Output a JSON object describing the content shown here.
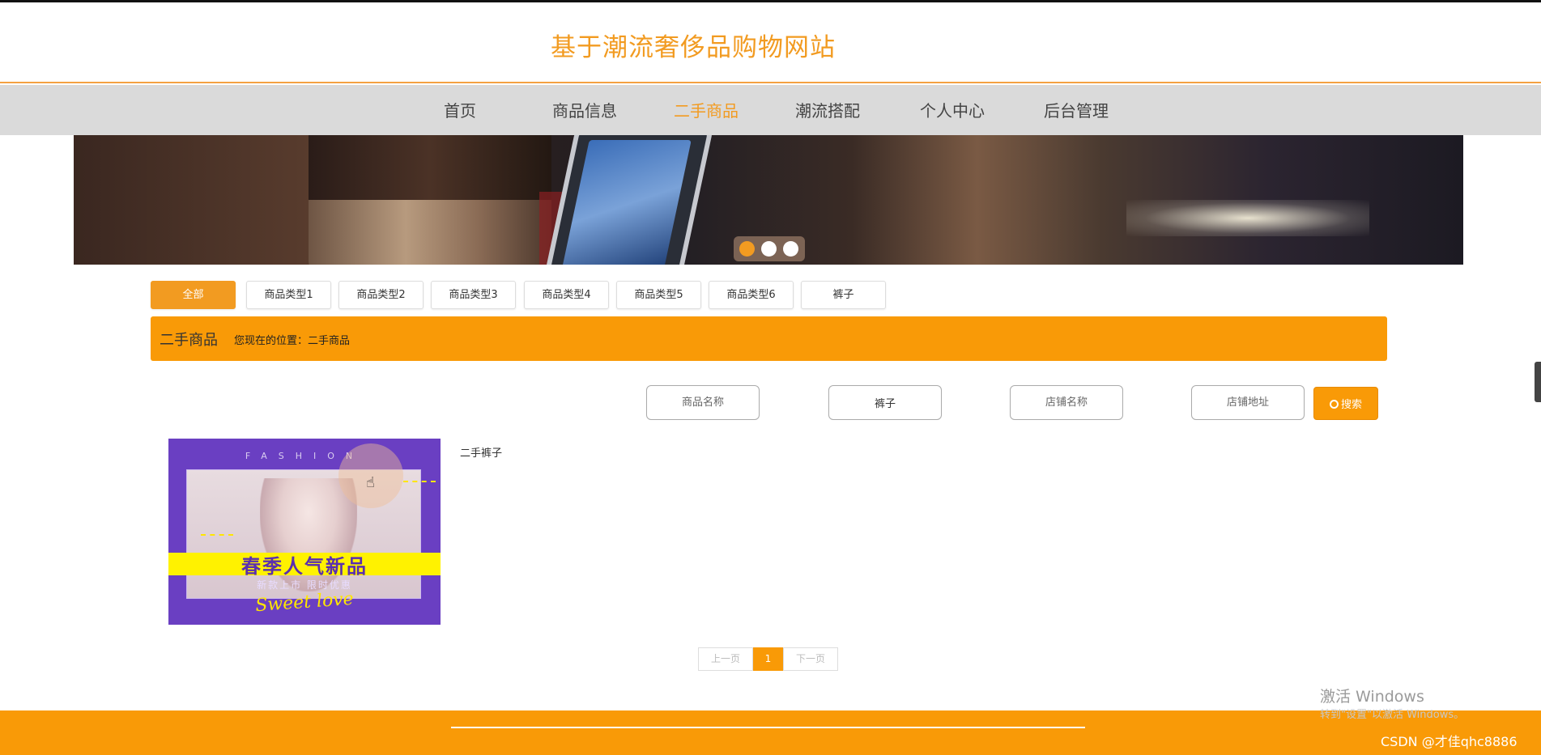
{
  "header": {
    "site_title": "基于潮流奢侈品购物网站"
  },
  "nav": {
    "items": [
      {
        "label": "首页"
      },
      {
        "label": "商品信息"
      },
      {
        "label": "二手商品",
        "active": true
      },
      {
        "label": "潮流搭配"
      },
      {
        "label": "个人中心"
      },
      {
        "label": "后台管理"
      }
    ]
  },
  "banner": {
    "slides": 3,
    "active_slide": 1
  },
  "categories": [
    {
      "label": "全部",
      "active": true
    },
    {
      "label": "商品类型1"
    },
    {
      "label": "商品类型2"
    },
    {
      "label": "商品类型3"
    },
    {
      "label": "商品类型4"
    },
    {
      "label": "商品类型5"
    },
    {
      "label": "商品类型6"
    },
    {
      "label": "裤子"
    }
  ],
  "breadcrumb": {
    "title": "二手商品",
    "location": "您现在的位置：二手商品"
  },
  "search": {
    "fields": [
      {
        "placeholder": "商品名称",
        "value": ""
      },
      {
        "placeholder": "",
        "value": "裤子"
      },
      {
        "placeholder": "店铺名称",
        "value": ""
      },
      {
        "placeholder": "店铺地址",
        "value": ""
      }
    ],
    "button_label": "搜索"
  },
  "products": [
    {
      "name": "二手裤子",
      "image_text": {
        "top": "FASHION",
        "headline": "春季人气新品",
        "sub": "新款上市 限时优惠",
        "script": "Sweet love"
      }
    }
  ],
  "pagination": {
    "prev": "上一页",
    "current": "1",
    "next": "下一页"
  },
  "overlay": {
    "activation_title": "激活 Windows",
    "activation_sub": "转到\"设置\"以激活 Windows。",
    "csdn_watermark": "CSDN @才佳qhc8886"
  },
  "colors": {
    "accent": "#f99a07",
    "title": "#f29b21",
    "nav_bg": "#dadada",
    "footer": "#f99a07"
  }
}
